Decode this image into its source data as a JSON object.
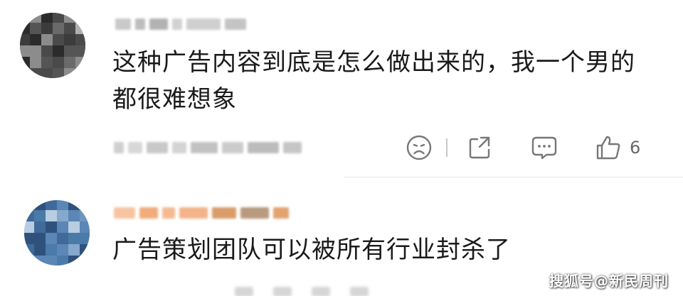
{
  "comments": [
    {
      "text": "这种广告内容到底是怎么做出来的，我一个男的都很难想象",
      "like_count": "6"
    },
    {
      "text": "广告策划团队可以被所有行业封杀了"
    }
  ],
  "actions": {
    "dislike_icon": "sad-face-icon",
    "share_icon": "share-icon",
    "reply_icon": "comment-icon",
    "like_icon": "thumbs-up-icon"
  },
  "watermark": "搜狐号@新民周刊",
  "colors": {
    "text": "#1a1a1a",
    "icon": "#777777",
    "divider": "#e4e4e4",
    "username_blur_2": "#f4b38a"
  }
}
